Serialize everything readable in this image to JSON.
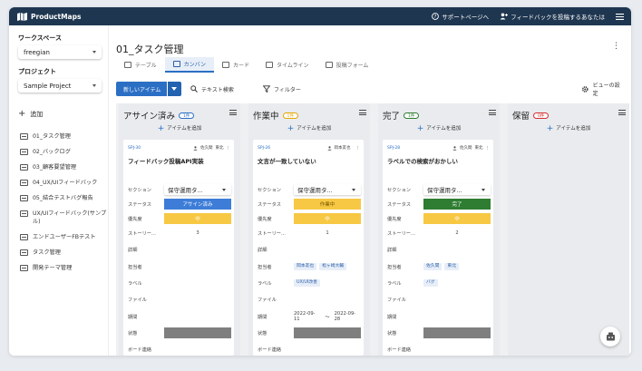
{
  "app": {
    "name": "ProductMaps"
  },
  "header": {
    "support": "サポートページへ",
    "feedback": "フィードバックを投稿するあなたは"
  },
  "sidebar": {
    "workspace_label": "ワークスペース",
    "workspace_value": "freegian",
    "project_label": "プロジェクト",
    "project_value": "Sample Project",
    "add_label": "追加",
    "items": [
      {
        "label": "01_タスク管理"
      },
      {
        "label": "02_バックログ"
      },
      {
        "label": "03_顧客要望管理"
      },
      {
        "label": "04_UX/UIフィードバック"
      },
      {
        "label": "05_結合テストバグ報告"
      },
      {
        "label": "UX/UIフィードバック(サンプル)"
      },
      {
        "label": "エンドユーザーFBテスト"
      },
      {
        "label": "タスク管理"
      },
      {
        "label": "開発テーマ管理"
      }
    ]
  },
  "main": {
    "title": "01_タスク管理",
    "tabs": [
      {
        "label": "テーブル"
      },
      {
        "label": "カンバン"
      },
      {
        "label": "カード"
      },
      {
        "label": "タイムライン"
      },
      {
        "label": "投稿フォーム"
      }
    ],
    "toolbar": {
      "new_item": "新しいアイテム",
      "text_search": "テキスト検索",
      "filter": "フィルター",
      "view_settings": "ビューの設定"
    }
  },
  "board": {
    "add_item_label": "アイテムを追加",
    "field_labels": {
      "section": "セクション",
      "status": "ステータス",
      "priority": "優先度",
      "story": "ストーリー...",
      "detail": "詳細",
      "assignee": "担当者",
      "label": "ラベル",
      "file": "ファイル",
      "period": "期間",
      "state": "状態",
      "board_link": "ボード連絡"
    },
    "columns": [
      {
        "title": "アサイン済み",
        "count": "1件",
        "pill_color": "#2b6fc4",
        "card": {
          "id": "SPJ-30",
          "owner": "佐久間",
          "tag": "東北",
          "title": "フィードバック投稿API実装",
          "section": "保守運用タ...",
          "status": "アサイン済み",
          "status_color": "#3d7dd8",
          "status_text_color": "#ffffff",
          "priority": "中",
          "story": "3",
          "assignees": [],
          "labels": [],
          "period_start": "",
          "period_tilde": "",
          "period_end": ""
        }
      },
      {
        "title": "作業中",
        "count": "1件",
        "pill_color": "#e6a700",
        "card": {
          "id": "SPJ-26",
          "owner": "岡本友也",
          "tag": "",
          "title": "文言が一致していない",
          "section": "保守運用タ...",
          "status": "作業中",
          "status_color": "#f7c843",
          "status_text_color": "#7a5a00",
          "priority": "中",
          "story": "1",
          "assignees": [
            "岡本友也",
            "松ヶ崎大輔"
          ],
          "labels": [
            "UX/UI改善"
          ],
          "period_start": "2022-09-11",
          "period_tilde": "〜",
          "period_end": "2022-09-28"
        }
      },
      {
        "title": "完了",
        "count": "1件",
        "pill_color": "#2e7d32",
        "card": {
          "id": "SPJ-28",
          "owner": "佐久間",
          "tag": "東北",
          "title": "ラベルでの検索がおかしい",
          "section": "保守運用タ...",
          "status": "完了",
          "status_color": "#2e7d32",
          "status_text_color": "#ffffff",
          "priority": "中",
          "story": "2",
          "assignees": [
            "佐久間",
            "東北"
          ],
          "labels": [
            "バグ"
          ],
          "period_start": "",
          "period_tilde": "",
          "period_end": ""
        }
      },
      {
        "title": "保留",
        "count": "0件",
        "pill_color": "#d32f2f",
        "card": null
      }
    ]
  },
  "colors": {
    "topbar": "#1f3650",
    "accent": "#2b6fc4",
    "priority": "#f7c843",
    "state_bar": "#7f7f7f"
  }
}
